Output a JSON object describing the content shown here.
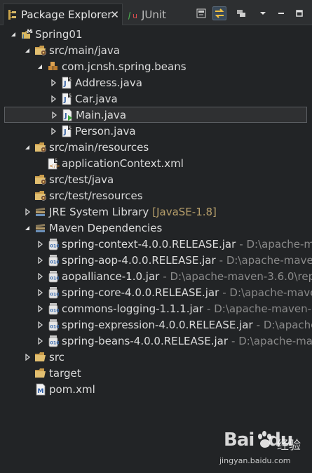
{
  "tabs": [
    {
      "label": "Package Explorer",
      "active": true,
      "icon": "package-explorer-icon"
    },
    {
      "label": "JUnit",
      "active": false,
      "icon": "junit-icon"
    }
  ],
  "tab_close_glyph": "✕",
  "toolbar": {
    "buttons": [
      "collapse-all-icon",
      "link-with-editor-icon",
      "focus-on-working-set-icon",
      "view-menu-icon",
      "minimize-icon",
      "maximize-icon"
    ]
  },
  "tree": [
    {
      "label": "Spring01",
      "level": 0,
      "twisty": "expanded",
      "icon": "project-icon"
    },
    {
      "label": "src/main/java",
      "level": 1,
      "twisty": "expanded",
      "icon": "source-folder-icon"
    },
    {
      "label": "com.jcnsh.spring.beans",
      "level": 2,
      "twisty": "expanded",
      "icon": "package-icon"
    },
    {
      "label": "Address.java",
      "level": 3,
      "twisty": "collapsed",
      "icon": "java-file-icon"
    },
    {
      "label": "Car.java",
      "level": 3,
      "twisty": "collapsed",
      "icon": "java-file-icon"
    },
    {
      "label": "Main.java",
      "level": 3,
      "twisty": "collapsed",
      "icon": "java-main-file-icon",
      "selected": true
    },
    {
      "label": "Person.java",
      "level": 3,
      "twisty": "collapsed",
      "icon": "java-file-icon"
    },
    {
      "label": "src/main/resources",
      "level": 1,
      "twisty": "expanded",
      "icon": "source-folder-icon"
    },
    {
      "label": "applicationContext.xml",
      "level": 2,
      "twisty": "none",
      "icon": "spring-xml-icon"
    },
    {
      "label": "src/test/java",
      "level": 1,
      "twisty": "none",
      "icon": "source-folder-icon"
    },
    {
      "label": "src/test/resources",
      "level": 1,
      "twisty": "none",
      "icon": "source-folder-icon"
    },
    {
      "label": "JRE System Library",
      "decoration": "[JavaSE-1.8]",
      "level": 1,
      "twisty": "collapsed",
      "icon": "library-icon"
    },
    {
      "label": "Maven Dependencies",
      "level": 1,
      "twisty": "expanded",
      "icon": "library-icon"
    },
    {
      "label": "spring-context-4.0.0.RELEASE.jar",
      "decoration": "- D:\\apache-ma",
      "level": 2,
      "twisty": "collapsed",
      "icon": "jar-icon"
    },
    {
      "label": "spring-aop-4.0.0.RELEASE.jar",
      "decoration": "- D:\\apache-maven-",
      "level": 2,
      "twisty": "collapsed",
      "icon": "jar-icon"
    },
    {
      "label": "aopalliance-1.0.jar",
      "decoration": "- D:\\apache-maven-3.6.0\\repo",
      "level": 2,
      "twisty": "collapsed",
      "icon": "jar-icon"
    },
    {
      "label": "spring-core-4.0.0.RELEASE.jar",
      "decoration": "- D:\\apache-maver",
      "level": 2,
      "twisty": "collapsed",
      "icon": "jar-icon"
    },
    {
      "label": "commons-logging-1.1.1.jar",
      "decoration": "- D:\\apache-maven-3",
      "level": 2,
      "twisty": "collapsed",
      "icon": "jar-icon"
    },
    {
      "label": "spring-expression-4.0.0.RELEASE.jar",
      "decoration": "- D:\\apache-",
      "level": 2,
      "twisty": "collapsed",
      "icon": "jar-icon"
    },
    {
      "label": "spring-beans-4.0.0.RELEASE.jar",
      "decoration": "- D:\\apache-mave",
      "level": 2,
      "twisty": "collapsed",
      "icon": "jar-icon"
    },
    {
      "label": "src",
      "level": 1,
      "twisty": "collapsed",
      "icon": "folder-icon"
    },
    {
      "label": "target",
      "level": 1,
      "twisty": "none",
      "icon": "folder-icon"
    },
    {
      "label": "pom.xml",
      "level": 1,
      "twisty": "none",
      "icon": "pom-file-icon"
    }
  ],
  "watermark": {
    "brand": "Bai",
    "brand2": "du",
    "cn": "经验",
    "url": "jingyan.baidu.com"
  },
  "colors": {
    "background": "#222426",
    "selection": "#2f3032",
    "decoration": "#8a8a8a",
    "jre_decoration": "#b79f6b"
  }
}
